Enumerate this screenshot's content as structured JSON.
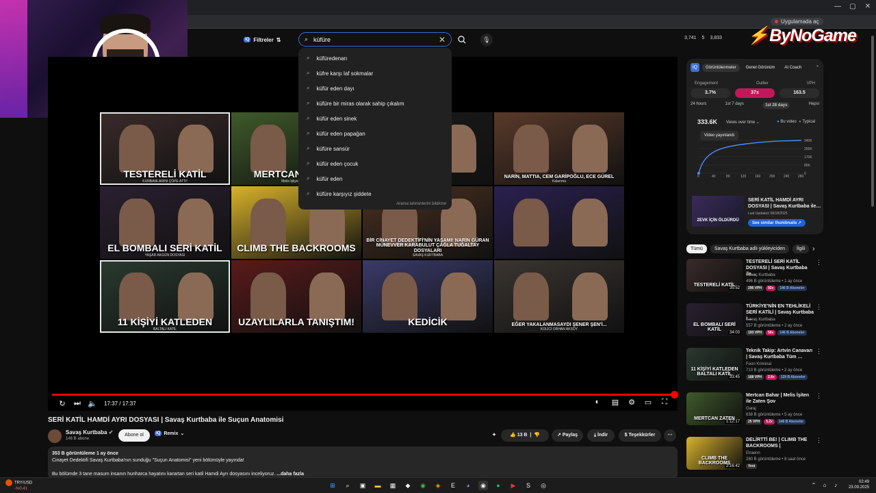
{
  "browser": {
    "notice": "Uygulamada aç",
    "window_buttons": [
      "—",
      "▢",
      "✕"
    ]
  },
  "branding": {
    "logo_text": "ByNoGame"
  },
  "header": {
    "filters_label": "Filtreler",
    "search_value": "küfüre",
    "stats": [
      "3,741",
      "5",
      "3,833"
    ]
  },
  "suggestions": {
    "items": [
      "küfüredenarı",
      "küfre karşı laf sokmalar",
      "küfür eden dayı",
      "küfüre bir miras olarak sahip çıkalım",
      "küfür eden sinek",
      "küfür eden papağan",
      "küfüre sansür",
      "küfür eden çocuk",
      "küfür eden",
      "küfüre karşıyız şiddete"
    ],
    "footer": "Arama tahminlerini bildirme"
  },
  "player": {
    "time": "17:37 / 17:37",
    "progress_fraction": 1.0,
    "tiles": [
      {
        "caption": "TESTERELİ KATİL",
        "sub": "KURBANLARINI ÇÖPE ATTI!",
        "bg": "#3a2a2a"
      },
      {
        "caption": "MERTCAN BAHAR",
        "sub": "Melis İşliyor ZATEN",
        "bg": "#3f5a2a"
      },
      {
        "caption": "…CISI",
        "sub": "",
        "bg": "#1a1a1a"
      },
      {
        "caption": "NARİN, MATTIA, CEM GARİPOĞLU, ECE GÜREL",
        "sub": "Kalarıma",
        "bg": "#5a3a2a"
      },
      {
        "caption": "EL BOMBALI SERİ KATİL",
        "sub": "YAŞAR AKGÜN DOSYASI",
        "bg": "#2a2030"
      },
      {
        "caption": "CLIMB THE BACKROOMS",
        "sub": "",
        "bg": "#d8b22a"
      },
      {
        "caption": "BİR CİNAYET DEDEKTİFİ'NİN YAŞAMI! NARİN GÜRAN MÜNEVVER KARABULUT ÇAĞLA TUĞALTAY DOSYALARI",
        "sub": "SAVAŞ KURTBABA",
        "bg": "#4a3020"
      },
      {
        "caption": "",
        "sub": "",
        "bg": "#2a2050"
      },
      {
        "caption": "11 KİŞİYİ KATLEDEN",
        "sub": "BALTALI KATİL",
        "bg": "#2a3a30"
      },
      {
        "caption": "UZAYLILARLA TANIŞTIM!",
        "sub": "",
        "bg": "#5a1a1a"
      },
      {
        "caption": "KEDİCİK",
        "sub": "",
        "bg": "#3a3a6a"
      },
      {
        "caption": "EĞER YAKALANMASAYDI ŞENER ŞEN'İ...",
        "sub": "KOLİCİ ORHAN AKSOY",
        "bg": "#3a3530"
      }
    ]
  },
  "video": {
    "title": "SERİ KATİL HAMDİ AYRI DOSYASI | Savaş Kurtbaba ile Suçun Anatomisi",
    "channel": "Savaş Kurtbaba",
    "subscribers": "146 B abone",
    "subscribe_label": "Abone ol",
    "remix_label": "Remix",
    "likes": "13 B",
    "share_label": "Paylaş",
    "download_label": "İndir",
    "thanks_label": "Teşekkürler",
    "desc_meta": "353 B görüntüleme  1 ay önce",
    "desc_line1": "Cinayet Dedektifi Savaş Kurtbaba'nın sunduğu \"Suçun Anatomisi\" yeni bölümüyle yayında!",
    "desc_line2": "Bu bölümde 3 tane masum insanın hunharca hayatını karartan seri katil Hamdi Ayrı dosyasını inceliyoruz.",
    "more_label": "...daha fazla"
  },
  "vidiq": {
    "tabs": [
      "Görüntülenmeler",
      "Genel Görünüm",
      "AI Coach"
    ],
    "metric_labels": [
      "Engagement",
      "Outlier",
      "VPH"
    ],
    "metric_values": [
      "3.7%",
      "37x",
      "163.5"
    ],
    "ranges": [
      "24 hours",
      "1st 7 days",
      "1st 28 days",
      "Hepsi"
    ],
    "views_total": "333.6K",
    "views_mode": "Views over time",
    "legend": [
      "Bu video",
      "Typical"
    ],
    "tooltip": "Video yayınlandı",
    "y_ticks": [
      "340K",
      "255K",
      "170K",
      "85K",
      "0"
    ],
    "x_ticks": [
      "0",
      "40",
      "80",
      "120",
      "160",
      "200",
      "240",
      "280"
    ],
    "thumb_caption": "ZEVK İÇİN ÖLDÜRDÜ",
    "rec_title": "SERİ KATİL HAMDİ AYRI DOSYASI | Savaş Kurtbaba ile…",
    "rec_updated": "Last Updated: 08/18/2025",
    "similar_label": "See similar thumbnails"
  },
  "chips": [
    "Tümü",
    "Savaş Kurtbaba adlı yükleyiciden",
    "İlgili"
  ],
  "recommendations": [
    {
      "title": "TESTERELİ SERİ KATİL DOSYASI | Savaş Kurtbaba ile…",
      "channel": "Savaş Kurtbaba",
      "views": "496 B görüntüleme • 1 ay önce",
      "duration": "35:52",
      "vph": "296 VPH",
      "mult": "92x",
      "subs": "146 B Aboneler",
      "thumb_caption": "TESTERELİ KATİL",
      "bg": "#3a2a2a"
    },
    {
      "title": "TÜRKİYE'NİN EN TEHLİKELİ SERİ KATİLİ | Savaş Kurtbaba i…",
      "channel": "Savaş Kurtbaba",
      "views": "557 B görüntüleme • 2 ay önce",
      "duration": "34:03",
      "vph": "193 VPH",
      "mult": "58x",
      "subs": "146 B Aboneler",
      "thumb_caption": "EL BOMBALI SERİ KATİL",
      "bg": "#2a2030"
    },
    {
      "title": "Teknik Takip: Artvin Canavarı | Savaş Kurtbaba Tüm …",
      "channel": "Fəon Kriminal",
      "views": "713 B görüntüleme • 2 ay önce",
      "duration": "33:45",
      "vph": "168 VPH",
      "mult": "2.8x",
      "subs": "129 B Aboneler",
      "thumb_caption": "11 KİŞİYİ KATLEDEN BALTALI KATİL",
      "bg": "#2a3a30"
    },
    {
      "title": "Mertcan Bahar | Melis İşiten ile Zaten Şov",
      "channel": "Garaj",
      "views": "638 B görüntüleme • 5 ay önce",
      "duration": "1:12:17",
      "vph": "25 VPH",
      "mult": "5.2x",
      "subs": "146 B Aboneler",
      "thumb_caption": "MERTCAN ZATEN",
      "bg": "#3f5a2a"
    },
    {
      "title": "DELİRTTİ BE! | CLIMB THE BACKROOMS |",
      "channel": "Elraenn",
      "views": "280 B görüntüleme • 8 saat önce",
      "duration": "2:16:42",
      "vph": "Yeni",
      "mult": "",
      "subs": "",
      "thumb_caption": "CLIMB THE BACKROOMS",
      "bg": "#d8b22a"
    }
  ],
  "taskbar": {
    "ticker": "TRY/USD",
    "ticker_change": "-%0,41",
    "time": "02:49",
    "date": "23.09.2025"
  },
  "colors": {
    "accent": "#ff0000",
    "vidiq_blue": "#1e63d8",
    "outlier": "#c2185b"
  }
}
